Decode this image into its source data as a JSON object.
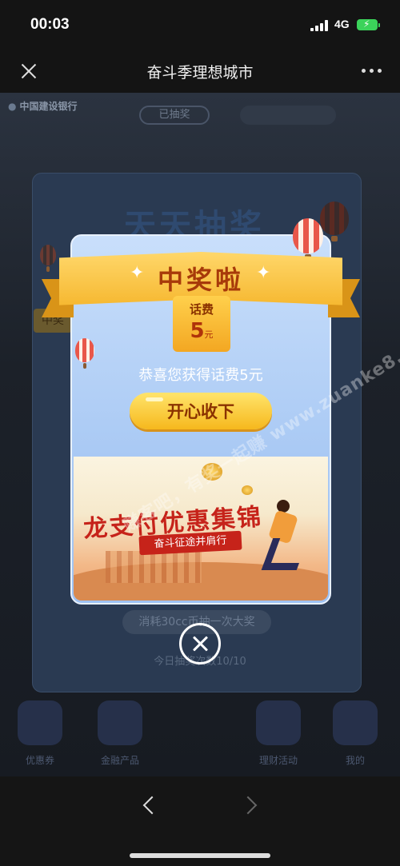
{
  "status_bar": {
    "time": "00:03",
    "network": "4G"
  },
  "nav": {
    "title": "奋斗季理想城市"
  },
  "background_page": {
    "bank_name": "中国建设银行",
    "pill_left": "已抽奖",
    "pill_right": "",
    "card_title": "天天抽奖",
    "side_label": "中奖",
    "line1": "消耗30cc币抽一次大奖",
    "line2": "今日抽奖次数10/10",
    "dock": [
      {
        "label": "优惠券"
      },
      {
        "label": "金融产品"
      },
      {
        "label": "理财活动"
      },
      {
        "label": "我的"
      }
    ]
  },
  "modal": {
    "ribbon_title": "中奖啦",
    "prize_type": "话费",
    "prize_amount": "5",
    "prize_unit": "元",
    "congrats_text": "恭喜您获得话费5元",
    "collect_button": "开心收下",
    "banner": {
      "title": "龙支付优惠集锦",
      "subtitle": "奋斗征途并肩行"
    }
  },
  "watermark": "赚客吧，有奖一起赚 www.zuanke8.com",
  "colors": {
    "accent": "#f6b81d",
    "ribbon_text": "#a73a0a",
    "modal_bg": "#a9c9f4"
  }
}
